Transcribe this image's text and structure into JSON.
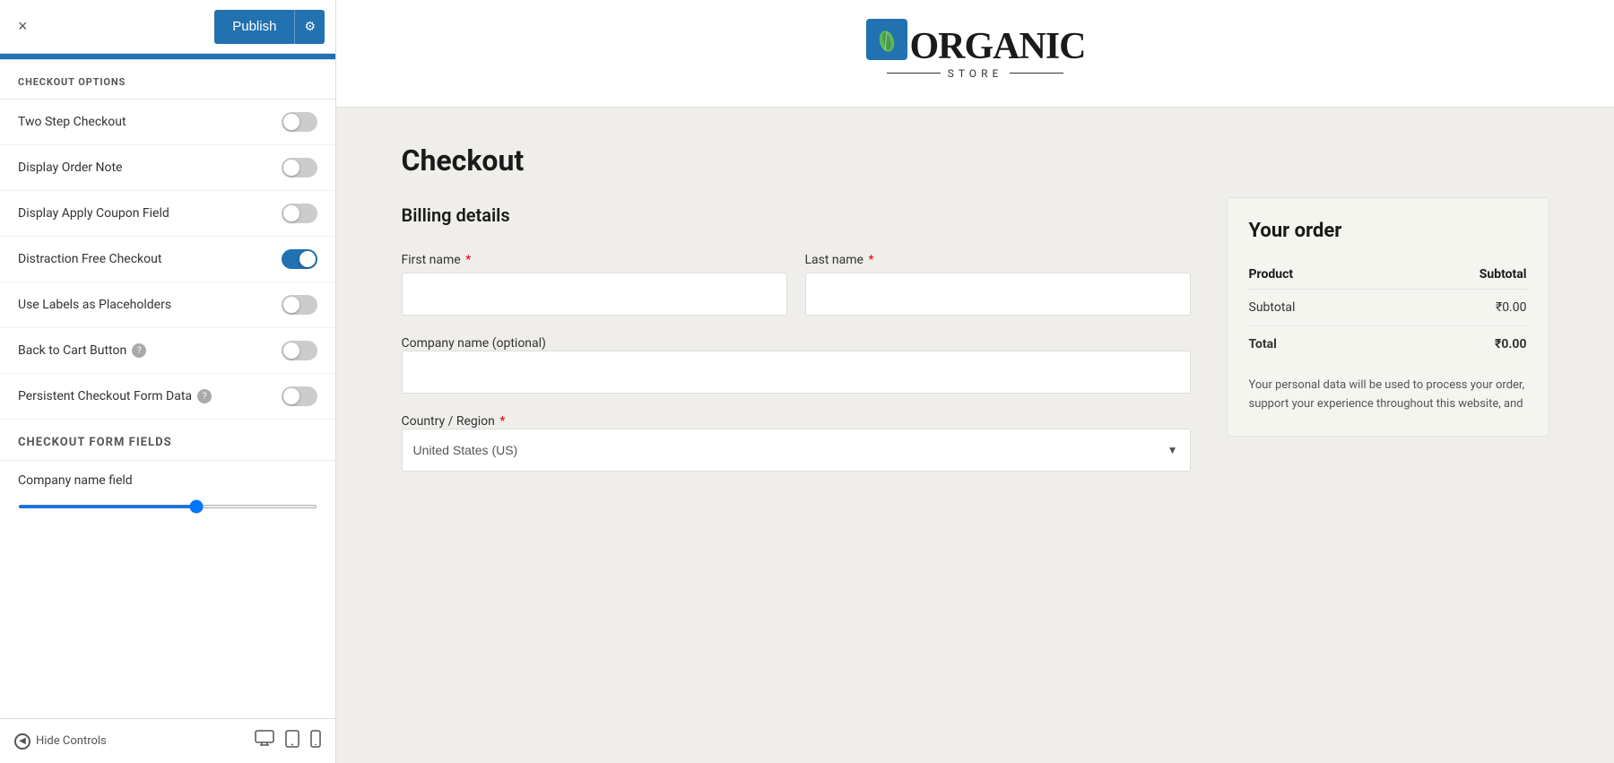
{
  "topbar": {
    "close_label": "×",
    "publish_label": "Publish",
    "settings_icon": "⚙"
  },
  "checkout_options": {
    "section_title": "CHECKOUT OPTIONS",
    "options": [
      {
        "id": "two_step",
        "label": "Two Step Checkout",
        "on": false,
        "has_help": false
      },
      {
        "id": "display_order_note",
        "label": "Display Order Note",
        "on": false,
        "has_help": false
      },
      {
        "id": "display_apply_coupon",
        "label": "Display Apply Coupon Field",
        "on": false,
        "has_help": false
      },
      {
        "id": "distraction_free",
        "label": "Distraction Free Checkout",
        "on": true,
        "has_help": false
      },
      {
        "id": "use_labels",
        "label": "Use Labels as Placeholders",
        "on": false,
        "has_help": false
      },
      {
        "id": "back_to_cart",
        "label": "Back to Cart Button",
        "on": false,
        "has_help": true
      },
      {
        "id": "persistent_checkout",
        "label": "Persistent Checkout Form Data",
        "on": false,
        "has_help": true
      }
    ]
  },
  "checkout_form_fields": {
    "section_title": "CHECKOUT FORM FIELDS",
    "company_field_label": "Company name field"
  },
  "bottom_bar": {
    "hide_controls_label": "Hide Controls",
    "desktop_icon": "🖥",
    "tablet_icon": "📱",
    "mobile_icon": "📱"
  },
  "preview": {
    "logo": {
      "icon": "🌿",
      "text": "ORGANIC",
      "sub": "STORE"
    },
    "checkout_title": "Checkout",
    "billing_details_title": "Billing details",
    "form": {
      "first_name_label": "First name",
      "last_name_label": "Last name",
      "company_label": "Company name (optional)",
      "country_label": "Country / Region",
      "country_value": "United States (US)"
    },
    "order": {
      "title": "Your order",
      "product_col": "Product",
      "subtotal_col": "Subtotal",
      "subtotal_label": "Subtotal",
      "subtotal_value": "₹0.00",
      "total_label": "Total",
      "total_value": "₹0.00",
      "privacy_text": "Your personal data will be used to process your order, support your experience throughout this website, and"
    }
  }
}
